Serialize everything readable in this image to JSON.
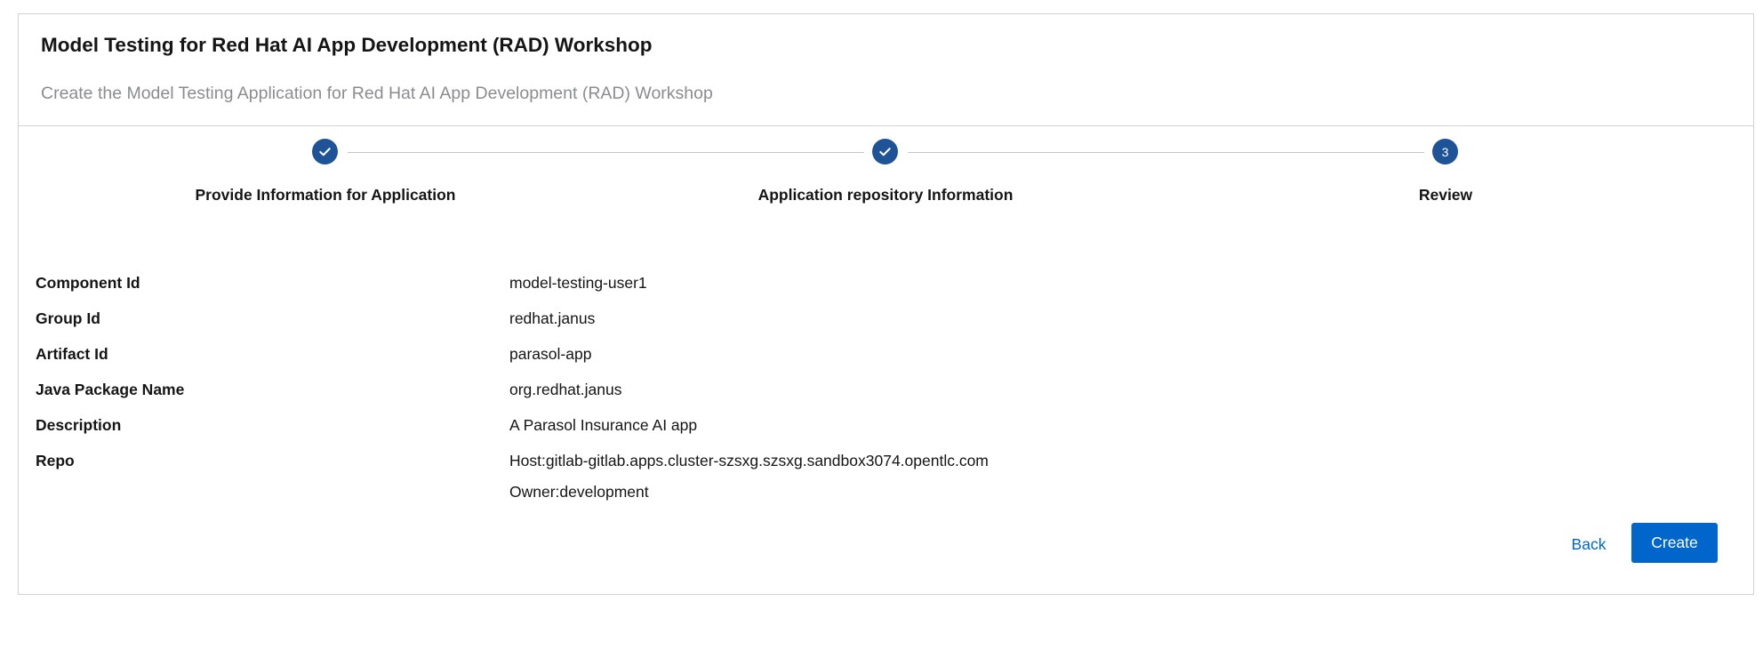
{
  "header": {
    "title": "Model Testing for Red Hat AI App Development (RAD) Workshop",
    "subtitle": "Create the Model Testing Application for Red Hat AI App Development (RAD) Workshop"
  },
  "stepper": {
    "steps": [
      {
        "label": "Provide Information for Application",
        "status": "completed",
        "icon": "check-icon"
      },
      {
        "label": "Application repository Information",
        "status": "completed",
        "icon": "check-icon"
      },
      {
        "label": "Review",
        "status": "active",
        "number": "3"
      }
    ],
    "accent_color": "#1f5398"
  },
  "review": {
    "fields": [
      {
        "label": "Component Id",
        "value": "model-testing-user1"
      },
      {
        "label": "Group Id",
        "value": "redhat.janus"
      },
      {
        "label": "Artifact Id",
        "value": "parasol-app"
      },
      {
        "label": "Java Package Name",
        "value": "org.redhat.janus"
      },
      {
        "label": "Description",
        "value": "A Parasol Insurance AI app"
      },
      {
        "label": "Repo",
        "value": "Host:gitlab-gitlab.apps.cluster-szsxg.szsxg.sandbox3074.opentlc.com",
        "value2": "Owner:development"
      }
    ]
  },
  "actions": {
    "back_label": "Back",
    "create_label": "Create",
    "primary_color": "#0066cc"
  }
}
